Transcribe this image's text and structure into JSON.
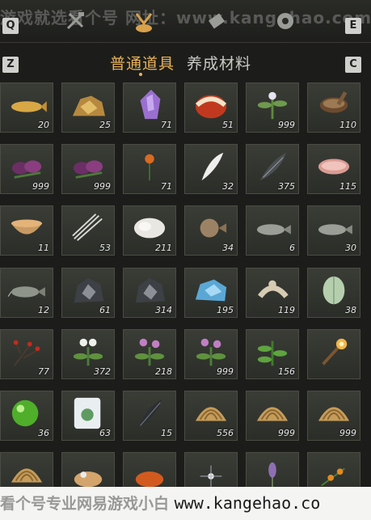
{
  "watermark_top": "游戏就选看个号 网址：www.kangehao.com",
  "keys": {
    "q": "Q",
    "e": "E",
    "z": "Z",
    "c": "C"
  },
  "top_icons": [
    "crossed-tools-icon",
    "pouch-icon",
    "scroll-icon",
    "gear-icon"
  ],
  "tabs": {
    "active": "普通道具",
    "inactive": "养成材料"
  },
  "slots": [
    {
      "count": "20",
      "icon": "golden-fish-icon"
    },
    {
      "count": "25",
      "icon": "gold-ore-icon"
    },
    {
      "count": "71",
      "icon": "purple-crystal-icon"
    },
    {
      "count": "51",
      "icon": "red-gem-icon"
    },
    {
      "count": "999",
      "icon": "herb-flower-icon"
    },
    {
      "count": "110",
      "icon": "mortar-icon"
    },
    {
      "count": "999",
      "icon": "purple-flower-icon"
    },
    {
      "count": "999",
      "icon": "purple-flower-icon"
    },
    {
      "count": "71",
      "icon": "orange-flower-icon"
    },
    {
      "count": "32",
      "icon": "white-feather-icon"
    },
    {
      "count": "375",
      "icon": "dark-feather-icon"
    },
    {
      "count": "115",
      "icon": "meat-icon"
    },
    {
      "count": "11",
      "icon": "bowl-icon"
    },
    {
      "count": "53",
      "icon": "quills-icon"
    },
    {
      "count": "211",
      "icon": "fur-icon"
    },
    {
      "count": "34",
      "icon": "pufferfish-icon"
    },
    {
      "count": "6",
      "icon": "grey-fish-icon"
    },
    {
      "count": "30",
      "icon": "grey-fish-icon"
    },
    {
      "count": "12",
      "icon": "catfish-icon"
    },
    {
      "count": "61",
      "icon": "dark-ore-icon"
    },
    {
      "count": "314",
      "icon": "dark-ore-icon"
    },
    {
      "count": "195",
      "icon": "blue-ore-icon"
    },
    {
      "count": "119",
      "icon": "bone-icon"
    },
    {
      "count": "38",
      "icon": "melon-icon"
    },
    {
      "count": "77",
      "icon": "red-berry-branch-icon"
    },
    {
      "count": "372",
      "icon": "white-flower-herb-icon"
    },
    {
      "count": "218",
      "icon": "pink-flower-herb-icon"
    },
    {
      "count": "999",
      "icon": "pink-flower-herb-icon"
    },
    {
      "count": "156",
      "icon": "green-herb-icon"
    },
    {
      "count": "",
      "icon": "torch-icon"
    },
    {
      "count": "36",
      "icon": "green-orb-icon"
    },
    {
      "count": "63",
      "icon": "jade-tablet-icon"
    },
    {
      "count": "15",
      "icon": "black-feather-icon"
    },
    {
      "count": "556",
      "icon": "shell-icon"
    },
    {
      "count": "999",
      "icon": "shell-icon"
    },
    {
      "count": "999",
      "icon": "shell-icon"
    },
    {
      "count": "",
      "icon": "shell-icon"
    },
    {
      "count": "",
      "icon": "pastry-icon"
    },
    {
      "count": "",
      "icon": "orange-item-icon"
    },
    {
      "count": "",
      "icon": "sparkle-item-icon"
    },
    {
      "count": "",
      "icon": "lavender-icon"
    },
    {
      "count": "",
      "icon": "fruit-branch-icon"
    }
  ],
  "bottom_banner": {
    "cn": "看个号专业网易游戏小白 ",
    "url": "www.kangehao.co"
  }
}
